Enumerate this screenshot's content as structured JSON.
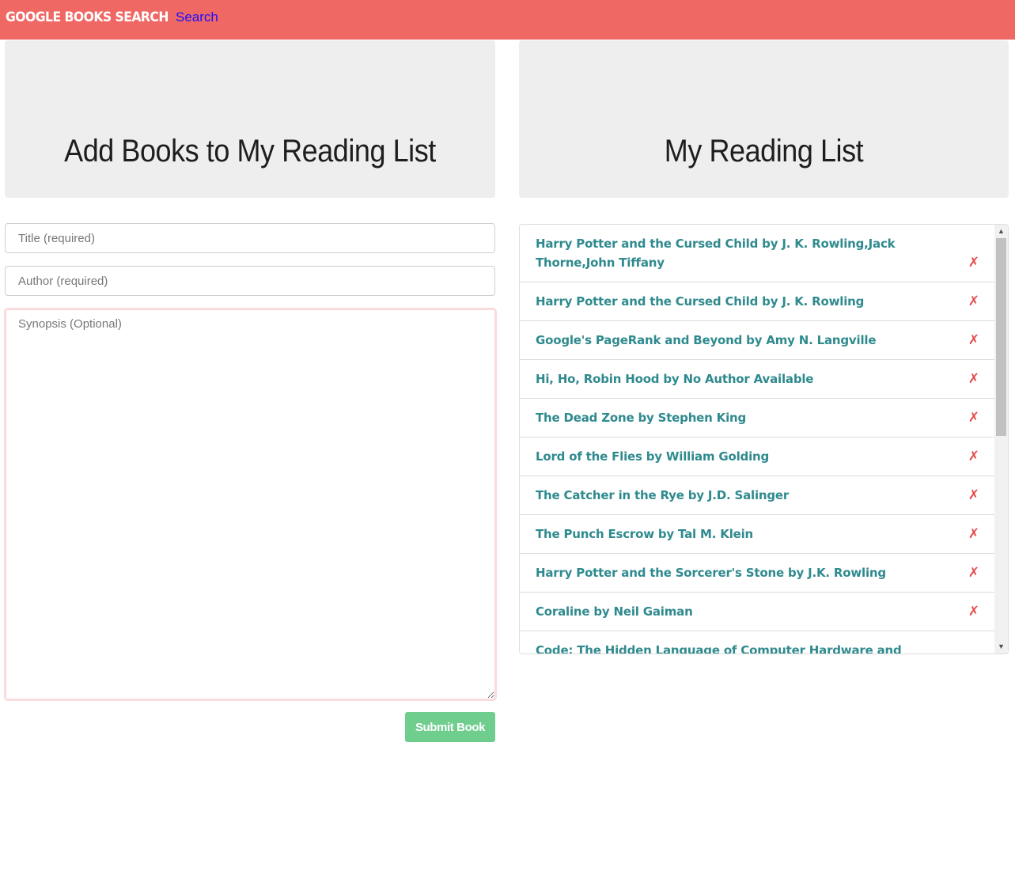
{
  "navbar": {
    "brand": "GOOGLE BOOKS SEARCH",
    "search_link": "Search"
  },
  "add_section": {
    "heading": "Add Books to My Reading List",
    "title_placeholder": "Title (required)",
    "author_placeholder": "Author (required)",
    "synopsis_placeholder": "Synopsis (Optional)",
    "submit_label": "Submit Book"
  },
  "reading_list": {
    "heading": "My Reading List",
    "delete_symbol": "✗",
    "items": [
      "Harry Potter and the Cursed Child by J. K. Rowling,Jack Thorne,John Tiffany",
      "Harry Potter and the Cursed Child by J. K. Rowling",
      "Google's PageRank and Beyond by Amy N. Langville",
      "Hi, Ho, Robin Hood by No Author Available",
      "The Dead Zone by Stephen King",
      "Lord of the Flies by William Golding",
      "The Catcher in the Rye by J.D. Salinger",
      "The Punch Escrow by Tal M. Klein",
      "Harry Potter and the Sorcerer's Stone by J.K. Rowling",
      "Coraline by Neil Gaiman",
      "Code: The Hidden Language of Computer Hardware and Software by"
    ]
  },
  "colors": {
    "navbar": "#ef6864",
    "nav_link": "#1a0dff",
    "jumbotron": "#eeeeee",
    "book_text": "#2f8a8e",
    "delete": "#e64b4b",
    "submit": "#6fce8d",
    "synopsis_border": "#fadcdc"
  }
}
